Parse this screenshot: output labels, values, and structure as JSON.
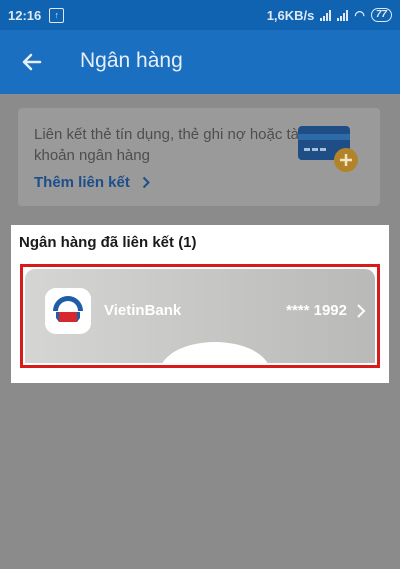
{
  "status_bar": {
    "time": "12:16",
    "speed": "1,6KB/s",
    "battery": "77"
  },
  "header": {
    "title": "Ngân hàng"
  },
  "link_card": {
    "description": "Liên kết thẻ tín dụng, thẻ ghi nợ hoặc tài khoản ngân hàng",
    "action_label": "Thêm liên kết"
  },
  "linked_banks": {
    "title": "Ngân hàng đã liên kết (1)",
    "items": [
      {
        "name": "VietinBank",
        "masked_number": "**** 1992"
      }
    ]
  },
  "colors": {
    "primary": "#1a6fc0",
    "status_bar": "#0f63b1",
    "highlight": "#d91a1a",
    "vietinbank_blue": "#1f5da8",
    "vietinbank_red": "#d7282e"
  }
}
